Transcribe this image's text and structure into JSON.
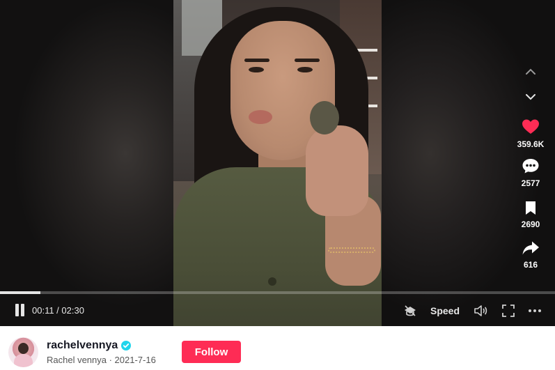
{
  "video": {
    "progress_fraction": 0.073,
    "time_label": "00:11 / 02:30",
    "speed_label": "Speed"
  },
  "actions": {
    "likes": "359.6K",
    "comments": "2577",
    "saves": "2690",
    "shares": "616"
  },
  "author": {
    "username": "rachelvennya",
    "subline": "Rachel vennya · 2021-7-16",
    "follow_label": "Follow"
  },
  "colors": {
    "like": "#fe2c55",
    "follow": "#fe2c55",
    "verified": "#20d5ec"
  },
  "icons": [
    "pause-icon",
    "pip-icon",
    "volume-icon",
    "fullscreen-icon",
    "more-icon",
    "chevron-up-icon",
    "chevron-down-icon",
    "heart-icon",
    "comment-icon",
    "bookmark-icon",
    "share-icon",
    "verified-icon"
  ]
}
